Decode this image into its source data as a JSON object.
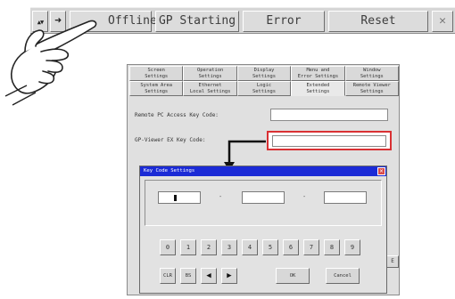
{
  "topbar": {
    "up_down_arrows": "▲▼",
    "right_arrow": "➜",
    "offline_label": "Offline",
    "gp_starting_label": "GP Starting",
    "error_label": "Error",
    "reset_label": "Reset",
    "close_glyph": "✕"
  },
  "tabs_row1": [
    "Screen\nSettings",
    "Operation\nSettings",
    "Display\nSettings",
    "Menu and\nError Settings",
    "Window\nSettings"
  ],
  "tabs_row2": [
    "System Area\nSettings",
    "Ethernet\nLocal Settings",
    "Logic\nSettings",
    "Extended\nSettings",
    "Remote Viewer\nSettings"
  ],
  "form": {
    "remote_pc_label": "Remote PC Access Key Code:",
    "gp_viewer_label": "GP-Viewer EX Key Code:"
  },
  "dialog": {
    "title": "Key Code Settings",
    "close_glyph": "✕",
    "dash": "-",
    "digit_keys": [
      "0",
      "1",
      "2",
      "3",
      "4",
      "5",
      "6",
      "7",
      "8",
      "9"
    ],
    "clr_label": "CLR",
    "bs_label": "BS",
    "left_arrow": "◀",
    "right_arrow": "▶",
    "ok_label": "OK",
    "cancel_label": "Cancel"
  },
  "window_stub_button": "E"
}
